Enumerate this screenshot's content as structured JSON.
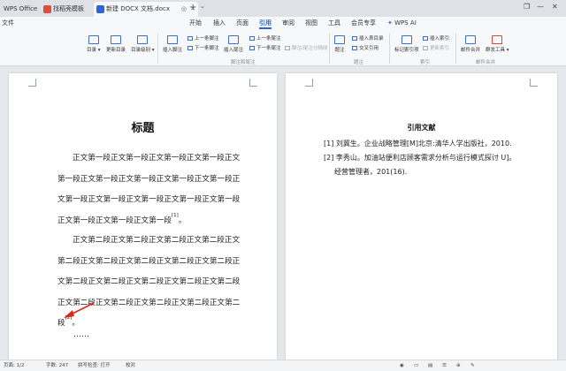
{
  "tabs": {
    "wps_office": "WPS Office",
    "template": "找稻壳模板",
    "document": "新建 DOCX 文档.docx",
    "new_tab": "+"
  },
  "menubar": {
    "file": "文件",
    "items": [
      "开始",
      "插入",
      "页面",
      "引用",
      "审阅",
      "视图",
      "工具",
      "会员专享"
    ],
    "active": "引用",
    "wps_ai": "WPS AI"
  },
  "ribbon": {
    "toc": "目录",
    "update_toc": "更新目录",
    "toc_level": "目录级别",
    "insert_footnote": "插入脚注",
    "prev_footnote": "上一条脚注",
    "next_footnote": "下一条脚注",
    "insert_endnote": "插入尾注",
    "prev_endnote": "上一条尾注",
    "next_endnote": "下一条尾注",
    "footnote_endnote_sep": "脚注/尾注分隔线",
    "group_footnote": "脚注和尾注",
    "caption": "题注",
    "insert_table_of_figures": "插入表目录",
    "cross_reference": "交叉引用",
    "group_caption": "题注",
    "mark_index": "标记索引项",
    "insert_index": "插入索引",
    "update_index": "更新索引",
    "group_index": "索引",
    "mail_merge": "邮件合并",
    "new_mail": "群发工具",
    "group_mail": "邮件合并"
  },
  "document": {
    "title": "标题",
    "para1_lines": [
      "正文第一段正文第一段正文第一段正文第一段正文",
      "第一段正文第一段正文第一段正文第一段正文第一段正",
      "文第一段正文第一段正文第一段正文第一段正文第一段"
    ],
    "para1_last": "正文第一段正文第一段正文第一段",
    "para1_ref": "[1]",
    "para1_end": "。",
    "para2_lines": [
      "正文第二段正文第二段正文第二段正文第二段正文",
      "第二段正文第二段正文第二段正文第二段正文第二段正",
      "文第二段正文第二段正文第二段正文第二段正文第二段",
      "正文第二段正文第二段正文第二段正文第二段正文第二"
    ],
    "para2_last": "段",
    "para2_ref": "[2]",
    "para2_end": "。",
    "ellipsis": "……",
    "ref_title": "引用文献",
    "ref1": "[1] 刘冀生。企业战略管理[M]北京:清华人学出版社，2010.",
    "ref2": "[2] 李秀山。加油站便利店顾客需求分析与运行模式探讨 U]。",
    "ref2_cont": "经营管理者，201(16)."
  },
  "status": {
    "page": "页面: 1/2",
    "words": "字数: 247",
    "spell": "拼写检查: 打开",
    "proof": "校对"
  },
  "colors": {
    "accent": "#2a66d9",
    "arrow": "#e0241b"
  }
}
